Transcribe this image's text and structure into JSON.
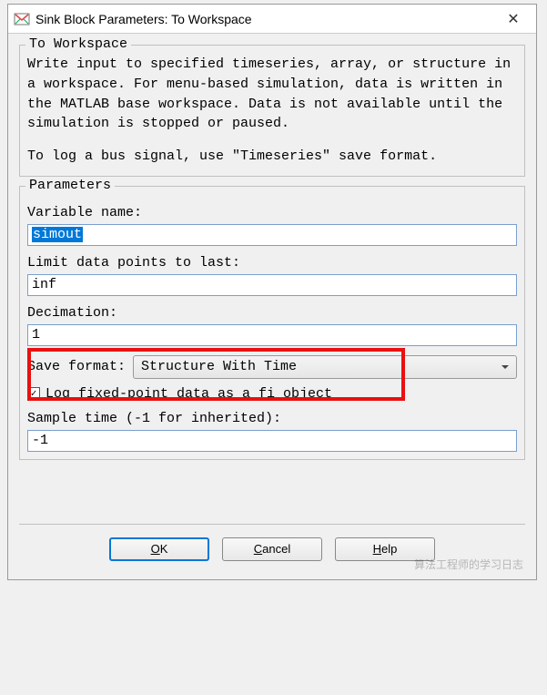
{
  "title": "Sink Block Parameters: To Workspace",
  "desc_group": {
    "label": "To Workspace",
    "text1": "Write input to specified timeseries, array, or structure in a workspace. For menu-based simulation, data is written in the MATLAB base workspace. Data is not available until the simulation is stopped or paused.",
    "text2": "To log a bus signal, use \"Timeseries\" save format."
  },
  "params": {
    "label": "Parameters",
    "var_name_label": "Variable name:",
    "var_name_value": "simout",
    "limit_label": "Limit data points to last:",
    "limit_value": "inf",
    "decimation_label": "Decimation:",
    "decimation_value": "1",
    "save_format_label": "Save format:",
    "save_format_value": "Structure With Time",
    "log_fi_checked": true,
    "log_fi_label": "Log fixed-point data as a fi object",
    "sample_time_label": "Sample time (-1 for inherited):",
    "sample_time_value": "-1"
  },
  "buttons": {
    "ok": "OK",
    "cancel": "Cancel",
    "help": "Help"
  },
  "watermark": "算法工程师的学习日志"
}
